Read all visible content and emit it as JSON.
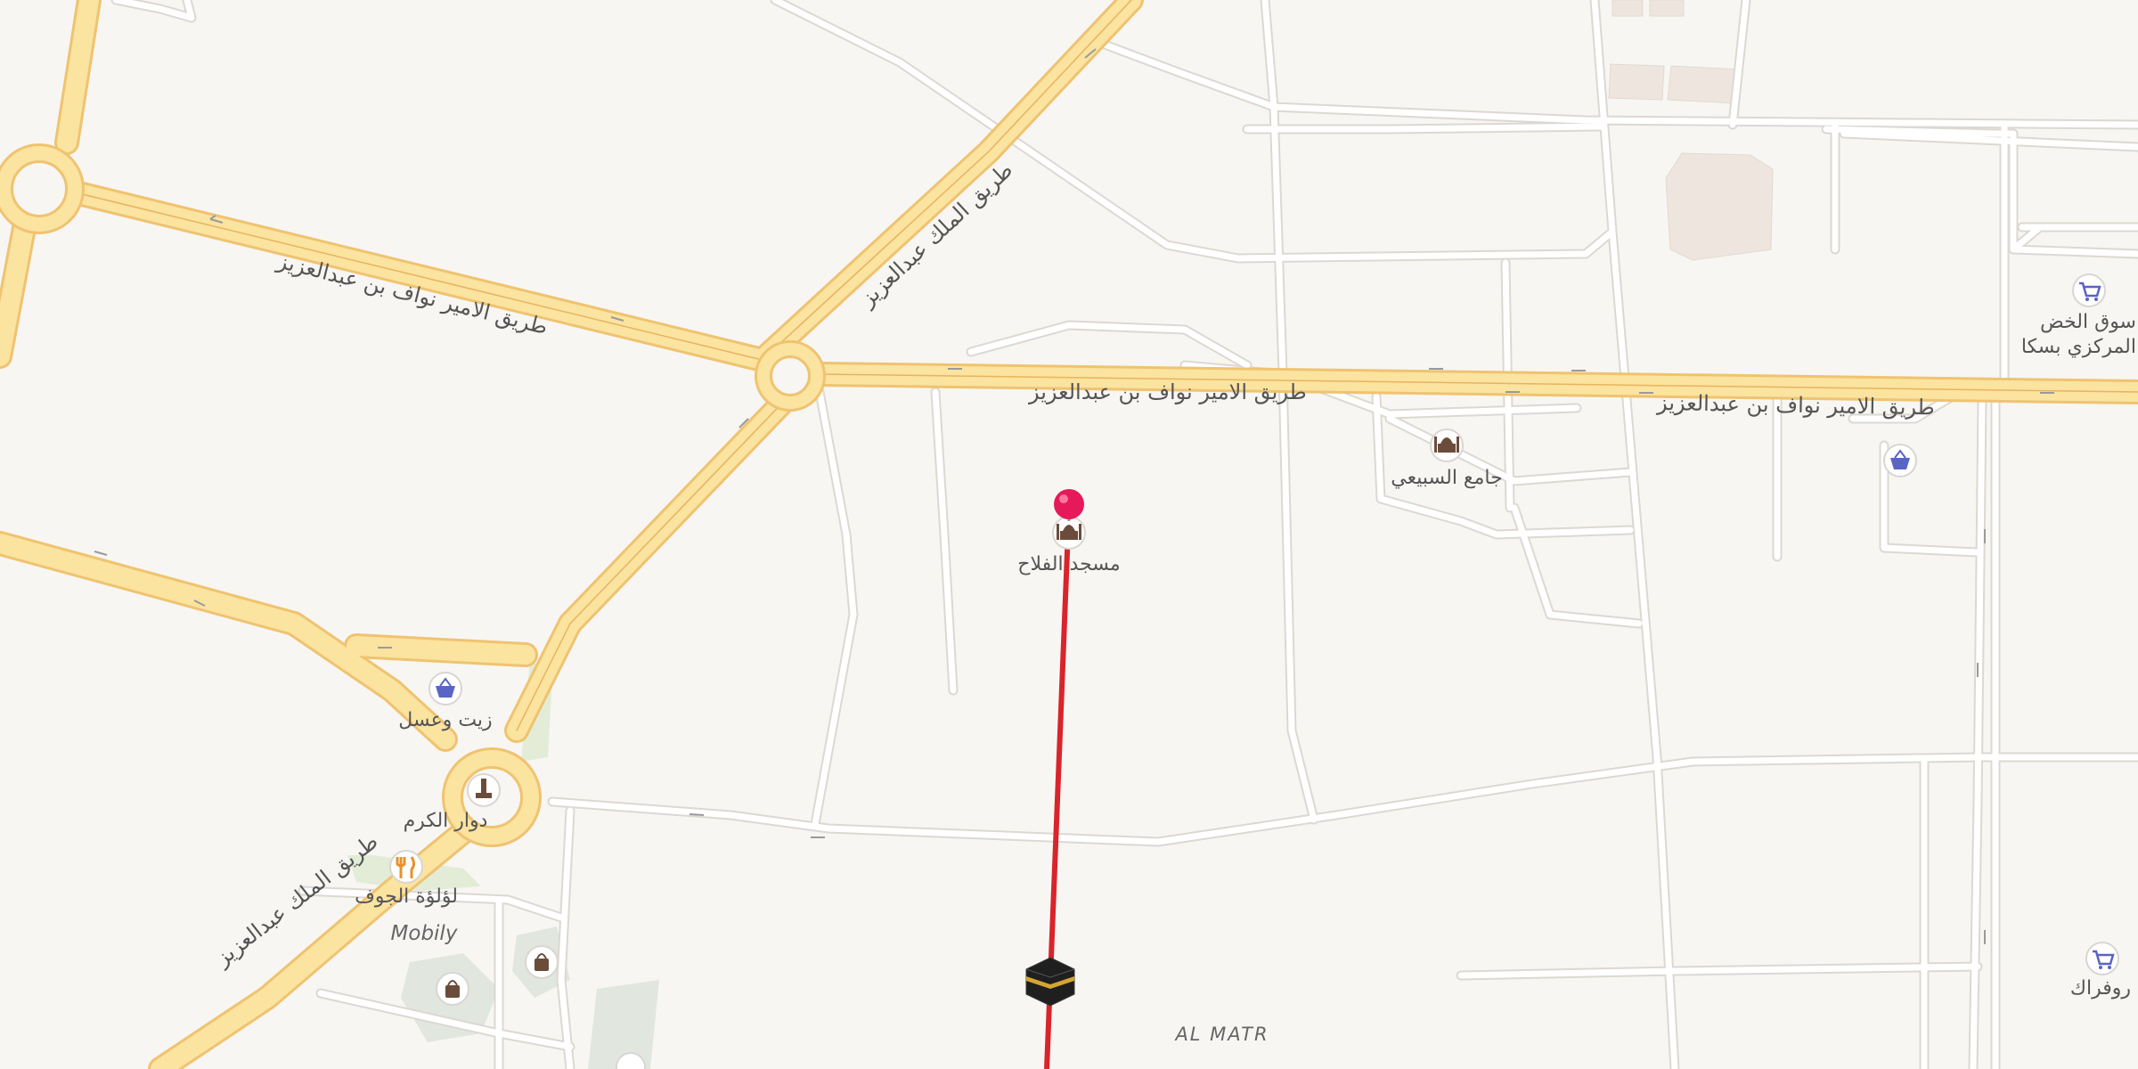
{
  "map": {
    "background": "#f8f6f3",
    "colors": {
      "major_road_fill": "#fbe3a0",
      "major_road_casing": "#efc370",
      "minor_road_fill": "#ffffff",
      "minor_road_casing": "#dcd8d2",
      "park": "#e2ecd7",
      "building": "#eee6de",
      "qibla_line": "#d9242b",
      "location_pin": "#e6195a",
      "shopping_icon": "#5a63c6",
      "food_icon": "#e8912b",
      "mosque_icon": "#6b4c3b"
    },
    "road_labels": [
      "طريق الامير نواف بن عبدالعزيز",
      "طريق الملك عبدالعزيز",
      "طريق الامير نواف بن عبدالعزيز",
      "طريق الامير نواف بن عبدالعزيز",
      "طريق الملك عبدالعزيز"
    ],
    "pois": [
      {
        "name": "مسجد الفلاح",
        "icon": "mosque-icon"
      },
      {
        "name": "جامع السبيعي",
        "icon": "mosque-icon"
      },
      {
        "name": "زيت وعسل",
        "icon": "shopping-basket-icon"
      },
      {
        "name": "دوار الكرم",
        "icon": "monument-icon"
      },
      {
        "name": "لؤلؤة الجوف",
        "icon": "restaurant-icon"
      },
      {
        "name": "سوق الخض",
        "icon": "shopping-cart-icon"
      },
      {
        "name": "المركزي بسكا",
        "icon": ""
      },
      {
        "name": "روفراك",
        "icon": "shopping-cart-icon"
      },
      {
        "name": "",
        "icon": "shopping-basket-icon"
      }
    ],
    "labels": {
      "mobily": "Mobily",
      "district": "AL MATR"
    },
    "qibla": {
      "icon": "kaaba-icon"
    },
    "current_location": {
      "icon": "location-pin-icon"
    }
  }
}
